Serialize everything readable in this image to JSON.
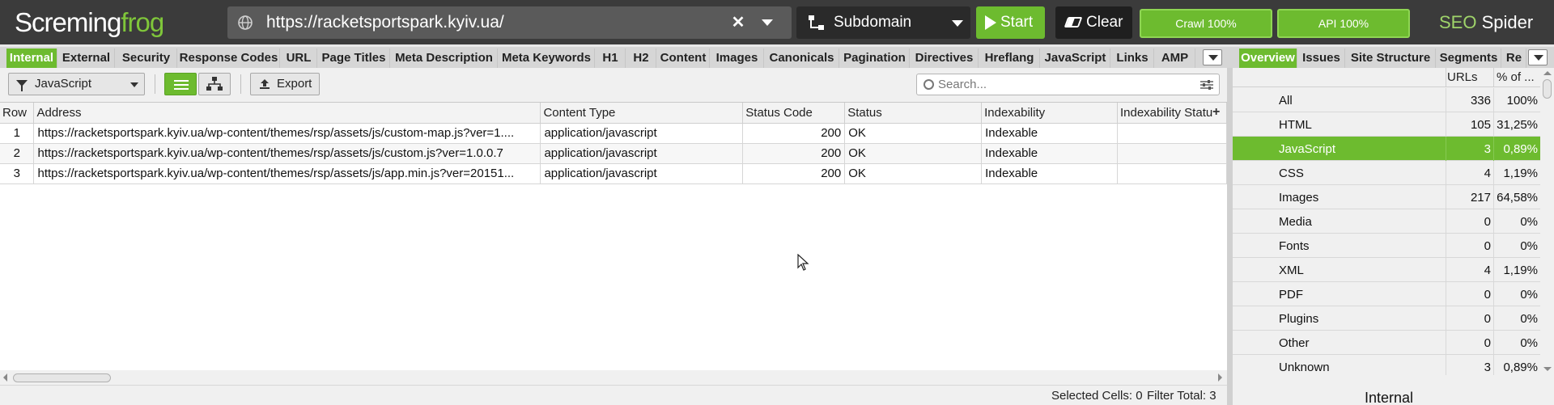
{
  "app": {
    "logo_part1": "Scre",
    "logo_part2": "ming",
    "logo_part3": "frog",
    "url": "https://racketsportspark.kyiv.ua/",
    "mode": "Subdomain",
    "start_label": "Start",
    "clear_label": "Clear",
    "crawl_status": "Crawl 100%",
    "api_status": "API 100%",
    "product_seo": "SEO",
    "product_spider": " Spider"
  },
  "tabs": [
    {
      "label": "Internal",
      "active": true
    },
    {
      "label": "External"
    },
    {
      "label": "Security"
    },
    {
      "label": "Response Codes"
    },
    {
      "label": "URL"
    },
    {
      "label": "Page Titles"
    },
    {
      "label": "Meta Description"
    },
    {
      "label": "Meta Keywords"
    },
    {
      "label": "H1"
    },
    {
      "label": "H2"
    },
    {
      "label": "Content"
    },
    {
      "label": "Images"
    },
    {
      "label": "Canonicals"
    },
    {
      "label": "Pagination"
    },
    {
      "label": "Directives"
    },
    {
      "label": "Hreflang"
    },
    {
      "label": "JavaScript"
    },
    {
      "label": "Links"
    },
    {
      "label": "AMP"
    }
  ],
  "right_tabs": [
    {
      "label": "Overview",
      "active": true
    },
    {
      "label": "Issues"
    },
    {
      "label": "Site Structure"
    },
    {
      "label": "Segments"
    },
    {
      "label": "Re"
    }
  ],
  "toolbar": {
    "filter": "JavaScript",
    "export_label": "Export",
    "search_placeholder": "Search..."
  },
  "table": {
    "columns": [
      "Row",
      "Address",
      "Content Type",
      "Status Code",
      "Status",
      "Indexability",
      "Indexability Statu"
    ],
    "rows": [
      {
        "row": "1",
        "address": "https://racketsportspark.kyiv.ua/wp-content/themes/rsp/assets/js/custom-map.js?ver=1....",
        "content_type": "application/javascript",
        "status_code": "200",
        "status": "OK",
        "indexability": "Indexable",
        "indexability_status": ""
      },
      {
        "row": "2",
        "address": "https://racketsportspark.kyiv.ua/wp-content/themes/rsp/assets/js/custom.js?ver=1.0.0.7",
        "content_type": "application/javascript",
        "status_code": "200",
        "status": "OK",
        "indexability": "Indexable",
        "indexability_status": ""
      },
      {
        "row": "3",
        "address": "https://racketsportspark.kyiv.ua/wp-content/themes/rsp/assets/js/app.min.js?ver=20151...",
        "content_type": "application/javascript",
        "status_code": "200",
        "status": "OK",
        "indexability": "Indexable",
        "indexability_status": ""
      }
    ]
  },
  "status_bar": {
    "selected_cells": "Selected Cells:  0",
    "filter_total": "Filter Total:  3"
  },
  "overview": {
    "col_urls": "URLs",
    "col_pct": "% of ...",
    "rows": [
      {
        "name": "All",
        "count": "336",
        "pct": "100%"
      },
      {
        "name": "HTML",
        "count": "105",
        "pct": "31,25%"
      },
      {
        "name": "JavaScript",
        "count": "3",
        "pct": "0,89%",
        "selected": true
      },
      {
        "name": "CSS",
        "count": "4",
        "pct": "1,19%"
      },
      {
        "name": "Images",
        "count": "217",
        "pct": "64,58%"
      },
      {
        "name": "Media",
        "count": "0",
        "pct": "0%"
      },
      {
        "name": "Fonts",
        "count": "0",
        "pct": "0%"
      },
      {
        "name": "XML",
        "count": "4",
        "pct": "1,19%"
      },
      {
        "name": "PDF",
        "count": "0",
        "pct": "0%"
      },
      {
        "name": "Plugins",
        "count": "0",
        "pct": "0%"
      },
      {
        "name": "Other",
        "count": "0",
        "pct": "0%"
      },
      {
        "name": "Unknown",
        "count": "3",
        "pct": "0,89%"
      }
    ],
    "footer_label": "Internal"
  },
  "colors": {
    "accent_green": "#6dbb2f",
    "topbar_bg": "#3b3b3b"
  }
}
